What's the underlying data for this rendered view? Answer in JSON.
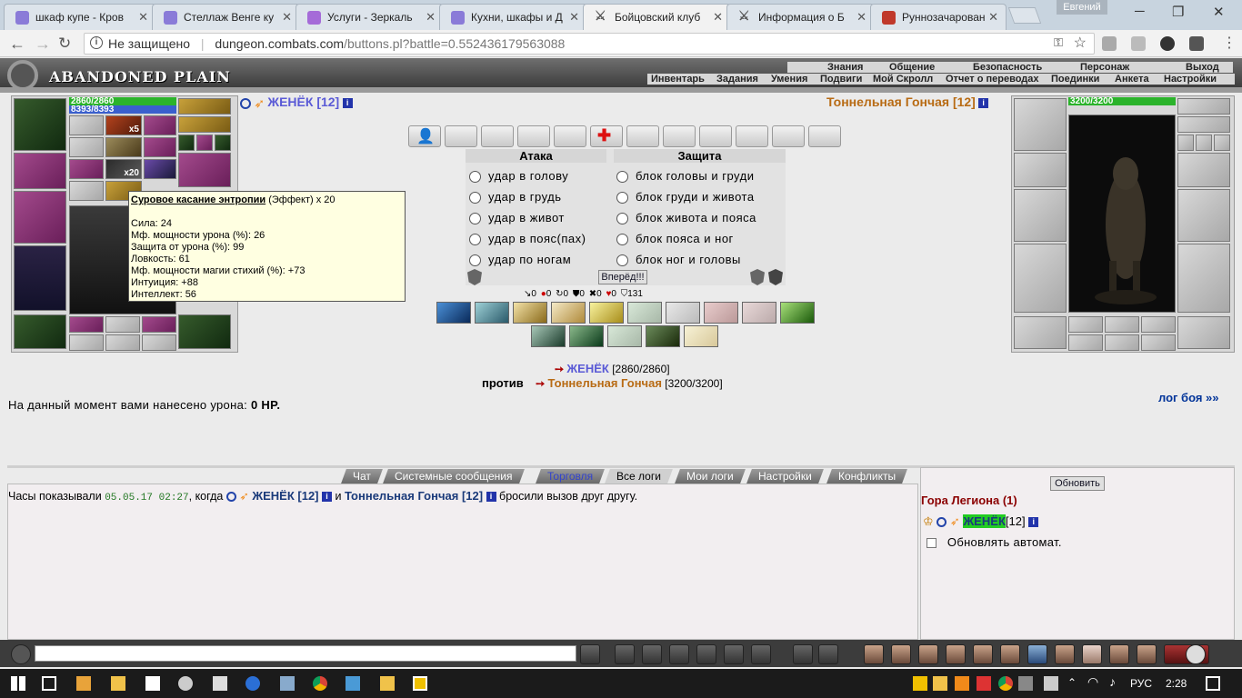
{
  "browser": {
    "tabs": [
      {
        "title": "шкаф купе - Кров",
        "icon_color": "#8a7bd8",
        "active": false
      },
      {
        "title": "Стеллаж Венге ку",
        "icon_color": "#8a7bd8",
        "active": false
      },
      {
        "title": "Услуги - Зеркаль",
        "icon_color": "#a56bd8",
        "active": false
      },
      {
        "title": "Кухни, шкафы и Д",
        "icon_color": "#8a7bd8",
        "active": false
      },
      {
        "title": "Бойцовский клуб",
        "icon_color": "#777777",
        "active": true
      },
      {
        "title": "Информация о Б",
        "icon_color": "#777777",
        "active": false
      },
      {
        "title": "Руннозачарован",
        "icon_color": "#c0392b",
        "active": false
      }
    ],
    "user_label": "Евгений",
    "security_label": "Не защищено",
    "url_host": "dungeon.combats.com",
    "url_path": "/buttons.pl?battle=0.552436179563088"
  },
  "game_header": {
    "logo": "ABANDONED PLAIN",
    "menu_top": [
      "Знания",
      "Общение",
      "Безопасность",
      "Персонаж",
      "Выход"
    ],
    "menu_bottom": [
      "Инвентарь",
      "Задания",
      "Умения",
      "Подвиги",
      "Мой Скролл",
      "Отчет о переводах",
      "Поединки",
      "Анкета",
      "Настройки"
    ]
  },
  "player": {
    "name": "ЖЕНЁК [12]",
    "hp": "2860/2860",
    "mana": "8393/8393",
    "badge": "x5",
    "badge2": "x20"
  },
  "enemy": {
    "name": "Тоннельная Гончая [12]",
    "hp": "3200/3200"
  },
  "tooltip": {
    "title": "Суровое касание энтропии",
    "subtitle": "(Эффект) x 20",
    "stats": [
      "Сила: 24",
      "Мф. мощности урона (%): 26",
      "Защита от урона (%): 99",
      "Ловкость: 61",
      "Мф. мощности магии стихий (%): +73",
      "Интуиция: +88",
      "Интеллект: 56"
    ]
  },
  "combat": {
    "attack_title": "Атака",
    "defense_title": "Защита",
    "attacks": [
      "удар в голову",
      "удар в грудь",
      "удар в живот",
      "удар в пояс(пах)",
      "удар по ногам"
    ],
    "defenses": [
      "блок головы и груди",
      "блок груди и живота",
      "блок живота и пояса",
      "блок пояса и ног",
      "блок ног и головы"
    ],
    "forward_button": "Вперёд!!!",
    "counters": [
      "0",
      "0",
      "0",
      "0",
      "0",
      "0",
      "131"
    ]
  },
  "battle_info": {
    "player_name": "ЖЕНЁК",
    "player_hp": "[2860/2860]",
    "vs_label": "против",
    "enemy_name": "Тоннельная Гончая",
    "enemy_hp": "[3200/3200]",
    "damage_prefix": "На данный момент вами нанесено урона:",
    "damage_value": "0 HP.",
    "log_link": "лог боя »»"
  },
  "chat_tabs": [
    "Чат",
    "Системные сообщения",
    "Торговля",
    "Все логи",
    "Мои логи",
    "Настройки",
    "Конфликты"
  ],
  "chat_log": {
    "prefix": "Часы показывали",
    "timestamp": "05.05.17 02:27",
    "mid": ", когда",
    "p1": "ЖЕНЁК [12]",
    "and": "и",
    "p2": "Тоннельная Гончая [12]",
    "suffix": "бросили вызов друг другу."
  },
  "sidebar": {
    "refresh_button": "Обновить",
    "location": "Гора Легиона (1)",
    "member_name": "ЖЕНЁК",
    "member_level": "[12]",
    "auto_refresh_label": "Обновлять автомат."
  },
  "taskbar": {
    "lang": "РУС",
    "time": "2:28"
  },
  "colors": {
    "player_name": "#5a5ad6",
    "enemy_name": "#b86b14",
    "hp_bar": "#2bb32b",
    "mana_bar": "#3a5fcd",
    "link_blue": "#003399"
  }
}
